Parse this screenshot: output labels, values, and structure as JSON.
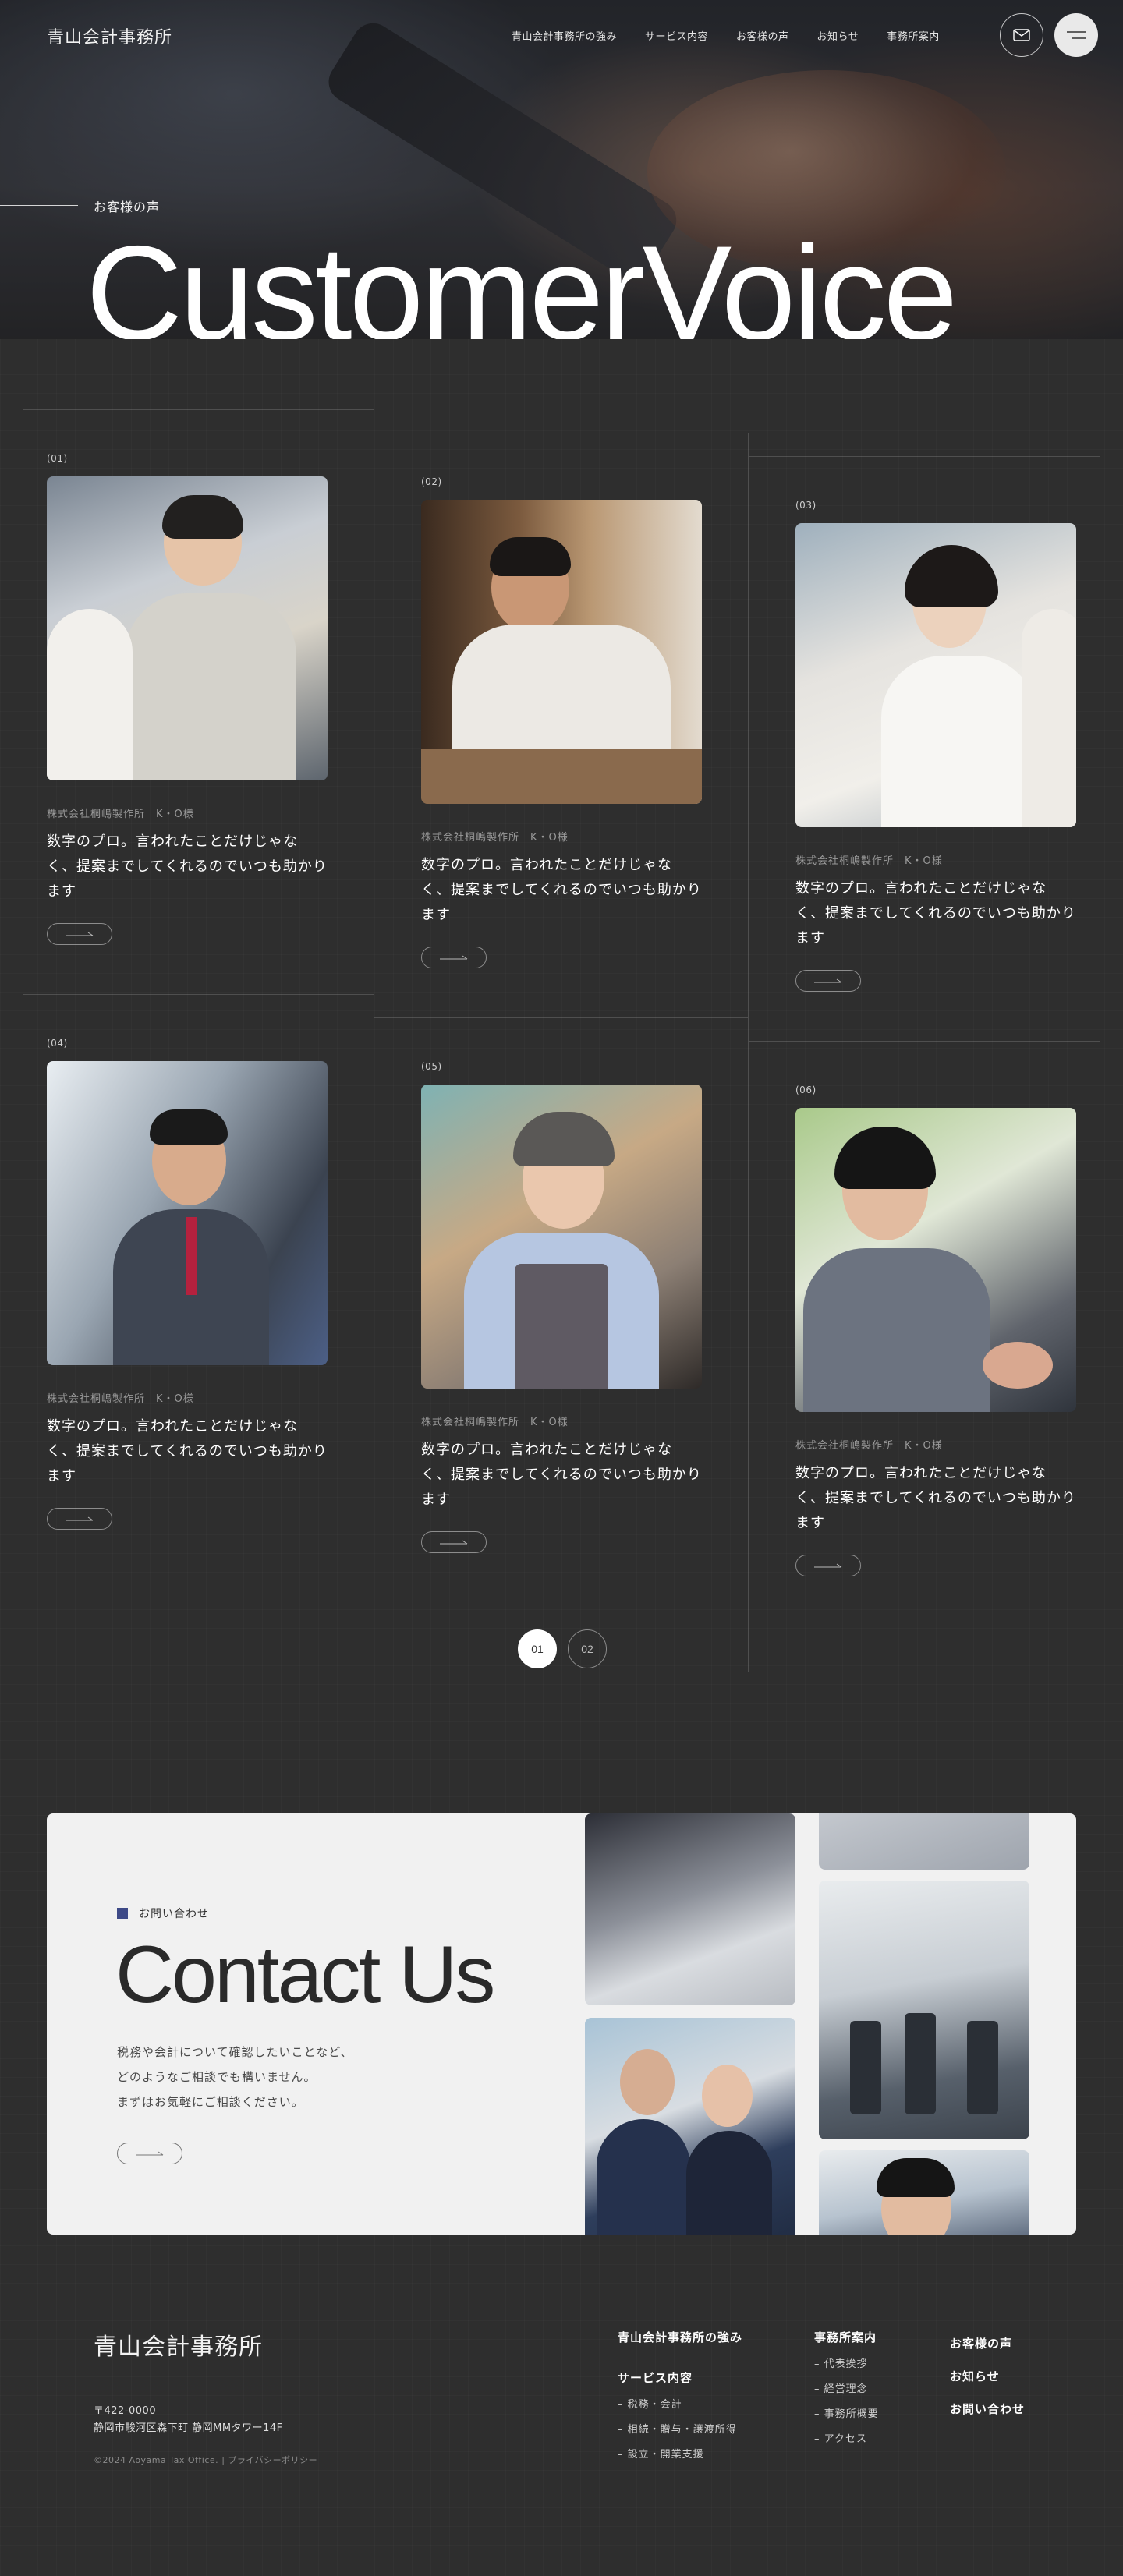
{
  "header": {
    "logo": "青山会計事務所",
    "nav": [
      "青山会計事務所の強み",
      "サービス内容",
      "お客様の声",
      "お知らせ",
      "事務所案内"
    ]
  },
  "hero": {
    "eyebrow": "お客様の声",
    "title": "CustomerVoice"
  },
  "cards": [
    {
      "num": "(01)",
      "company": "株式会社桐嶋製作所　K・O様",
      "quote": "数字のプロ。言われたことだけじゃなく、提案までしてくれるのでいつも助かります"
    },
    {
      "num": "(02)",
      "company": "株式会社桐嶋製作所　K・O様",
      "quote": "数字のプロ。言われたことだけじゃなく、提案までしてくれるのでいつも助かります"
    },
    {
      "num": "(03)",
      "company": "株式会社桐嶋製作所　K・O様",
      "quote": "数字のプロ。言われたことだけじゃなく、提案までしてくれるのでいつも助かります"
    },
    {
      "num": "(04)",
      "company": "株式会社桐嶋製作所　K・O様",
      "quote": "数字のプロ。言われたことだけじゃなく、提案までしてくれるのでいつも助かります"
    },
    {
      "num": "(05)",
      "company": "株式会社桐嶋製作所　K・O様",
      "quote": "数字のプロ。言われたことだけじゃなく、提案までしてくれるのでいつも助かります"
    },
    {
      "num": "(06)",
      "company": "株式会社桐嶋製作所　K・O様",
      "quote": "数字のプロ。言われたことだけじゃなく、提案までしてくれるのでいつも助かります"
    }
  ],
  "pagination": {
    "pages": [
      "01",
      "02"
    ],
    "current": "01"
  },
  "contact": {
    "tag": "お問い合わせ",
    "title": "Contact Us",
    "desc": [
      "税務や会計について確認したいことなど、",
      "どのようなご相談でも構いません。",
      "まずはお気軽にご相談ください。"
    ]
  },
  "footer": {
    "logo": "青山会計事務所",
    "postal": "〒422-0000",
    "address": "静岡市駿河区森下町 静岡MMタワー14F",
    "copyright": "©2024 Aoyama Tax Office.",
    "privacy": "プライバシーポリシー",
    "col1": {
      "heading1": "青山会計事務所の強み",
      "heading2": "サービス内容",
      "items": [
        "税務・会計",
        "相続・贈与・譲渡所得",
        "設立・開業支援"
      ]
    },
    "col2": {
      "heading": "事務所案内",
      "items": [
        "代表挨拶",
        "経営理念",
        "事務所概要",
        "アクセス"
      ]
    },
    "col3": {
      "items": [
        "お客様の声",
        "お知らせ",
        "お問い合わせ"
      ]
    }
  },
  "icons": {
    "mail": "mail-icon",
    "menu": "menu-icon",
    "arrow": "arrow-right-icon"
  },
  "colors": {
    "background": "#2e2e2e",
    "accent": "#3e4a87",
    "contact_bg": "#f1f1f1"
  }
}
